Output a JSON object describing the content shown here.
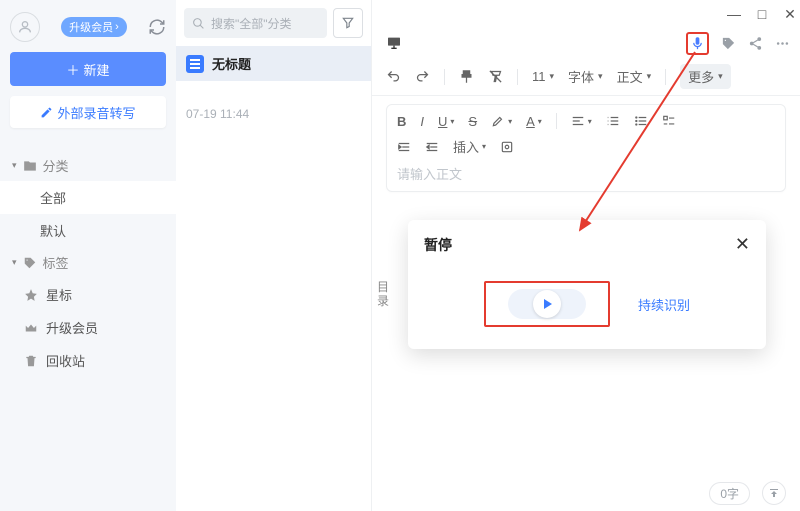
{
  "sidebar": {
    "upgrade_badge": "升级会员",
    "new_button": "新建",
    "ext_transcribe": "外部录音转写",
    "category_section": "分类",
    "items": {
      "all": "全部",
      "default": "默认"
    },
    "tag_section": "标签",
    "star": "星标",
    "upgrade": "升级会员",
    "recycle": "回收站"
  },
  "midcol": {
    "search_placeholder": "搜索\"全部\"分类",
    "note_title": "无标题",
    "note_date": "07-19 11:44"
  },
  "toolbar": {
    "fontsize": "11",
    "font_label": "字体",
    "body_label": "正文",
    "more": "更多",
    "insert": "插入"
  },
  "editor": {
    "placeholder": "请输入正文",
    "toc": "目录"
  },
  "popup": {
    "title": "暂停",
    "continue": "持续识别"
  },
  "footer": {
    "char_count": "0字"
  }
}
